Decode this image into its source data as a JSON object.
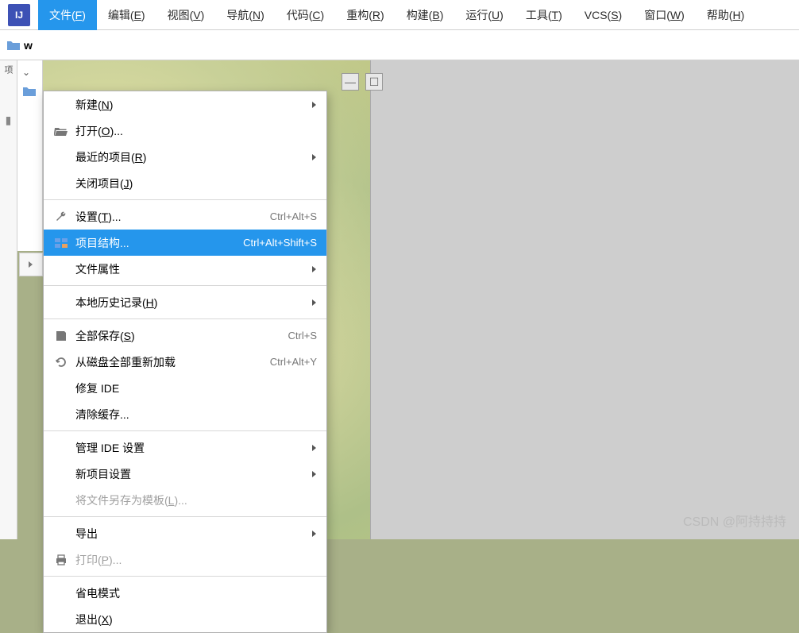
{
  "menubar": {
    "items": [
      {
        "label": "文件",
        "accel": "F",
        "active": true
      },
      {
        "label": "编辑",
        "accel": "E"
      },
      {
        "label": "视图",
        "accel": "V"
      },
      {
        "label": "导航",
        "accel": "N"
      },
      {
        "label": "代码",
        "accel": "C"
      },
      {
        "label": "重构",
        "accel": "R"
      },
      {
        "label": "构建",
        "accel": "B"
      },
      {
        "label": "运行",
        "accel": "U"
      },
      {
        "label": "工具",
        "accel": "T"
      },
      {
        "label": "VCS",
        "accel": "S"
      },
      {
        "label": "窗口",
        "accel": "W"
      },
      {
        "label": "帮助",
        "accel": "H"
      }
    ]
  },
  "toolbar": {
    "project": "w"
  },
  "gutter": {
    "label": "项"
  },
  "dropdown": {
    "items": [
      {
        "label": "新建",
        "accel": "N",
        "icon": "",
        "submenu": true
      },
      {
        "label": "打开",
        "accel": "O",
        "suffix": "...",
        "icon": "folder-open"
      },
      {
        "label": "最近的项目",
        "accel": "R",
        "icon": "",
        "submenu": true
      },
      {
        "label": "关闭项目",
        "accel": "J",
        "icon": ""
      },
      {
        "sep": true
      },
      {
        "label": "设置",
        "accel": "T",
        "suffix": "...",
        "icon": "wrench",
        "shortcut": "Ctrl+Alt+S"
      },
      {
        "label": "项目结构...",
        "icon": "project-structure",
        "shortcut": "Ctrl+Alt+Shift+S",
        "highlighted": true
      },
      {
        "label": "文件属性",
        "submenu": true
      },
      {
        "sep": true
      },
      {
        "label": "本地历史记录",
        "accel": "H",
        "submenu": true
      },
      {
        "sep": true
      },
      {
        "label": "全部保存",
        "accel": "S",
        "icon": "save",
        "shortcut": "Ctrl+S"
      },
      {
        "label": "从磁盘全部重新加载",
        "icon": "reload",
        "shortcut": "Ctrl+Alt+Y"
      },
      {
        "label": "修复 IDE"
      },
      {
        "label": "清除缓存..."
      },
      {
        "sep": true
      },
      {
        "label": "管理 IDE 设置",
        "submenu": true
      },
      {
        "label": "新项目设置",
        "submenu": true
      },
      {
        "label": "将文件另存为模板",
        "accel": "L",
        "suffix": "...",
        "disabled": true
      },
      {
        "sep": true
      },
      {
        "label": "导出",
        "submenu": true
      },
      {
        "label": "打印",
        "accel": "P",
        "suffix": "...",
        "icon": "print",
        "disabled": true
      },
      {
        "sep": true
      },
      {
        "label": "省电模式"
      },
      {
        "label": "退出",
        "accel": "X"
      }
    ]
  },
  "watermark": "CSDN @阿持持持"
}
